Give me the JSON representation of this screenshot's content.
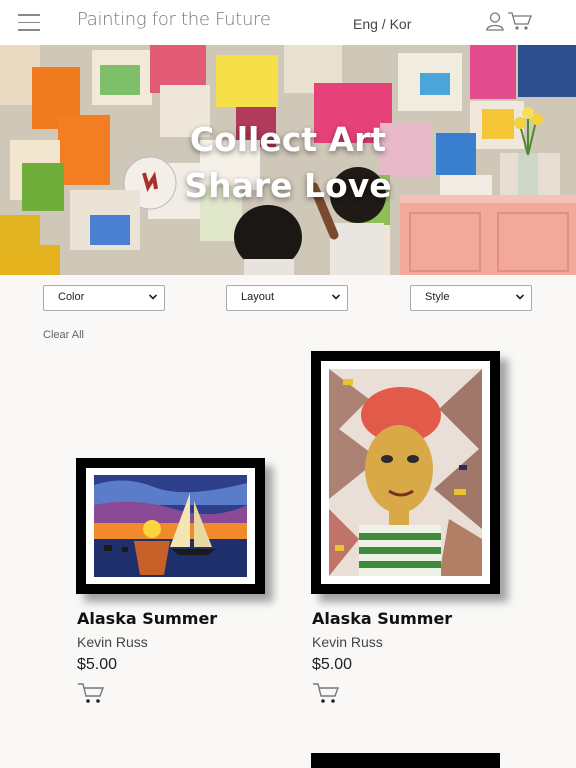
{
  "header": {
    "brand": "Painting for the Future",
    "lang_en": "Eng",
    "lang_sep": " / ",
    "lang_kr": "Kor"
  },
  "hero": {
    "line1": "Collect Art",
    "line2": "Share Love"
  },
  "filters": {
    "color": "Color",
    "layout": "Layout",
    "style": "Style",
    "clear_all": "Clear All"
  },
  "products": [
    {
      "title": "Alaska Summer",
      "artist": "Kevin Russ",
      "price": "$5.00"
    },
    {
      "title": "Alaska Summer",
      "artist": "Kevin Russ",
      "price": "$5.00"
    }
  ],
  "colors": {
    "header_bg": "#ffffff",
    "page_bg": "#f9f8f6",
    "brand_text": "#777777",
    "frame": "#000000"
  }
}
